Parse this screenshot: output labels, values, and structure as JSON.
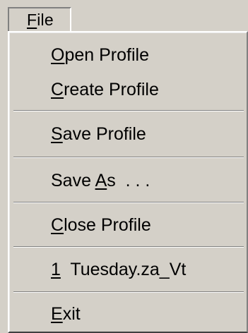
{
  "menubar": {
    "file_menu": {
      "mnemonic": "F",
      "rest": "ile"
    }
  },
  "dropdown": {
    "items": [
      {
        "mnemonic": "O",
        "rest": "pen Profile"
      },
      {
        "mnemonic": "C",
        "rest": "reate Profile"
      },
      {
        "mnemonic": "S",
        "rest": "ave Profile"
      },
      {
        "before": "Save ",
        "mnemonic": "A",
        "rest": "s  . . ."
      },
      {
        "mnemonic": "C",
        "rest": "lose Profile"
      },
      {
        "mnemonic": "1",
        "rest": "  Tuesday.za_Vt"
      },
      {
        "mnemonic": "E",
        "rest": "xit"
      }
    ]
  },
  "colors": {
    "face": "#d4d0c8",
    "highlight": "#ffffff",
    "shadow": "#808080",
    "dark_shadow": "#404040",
    "text": "#000000"
  }
}
